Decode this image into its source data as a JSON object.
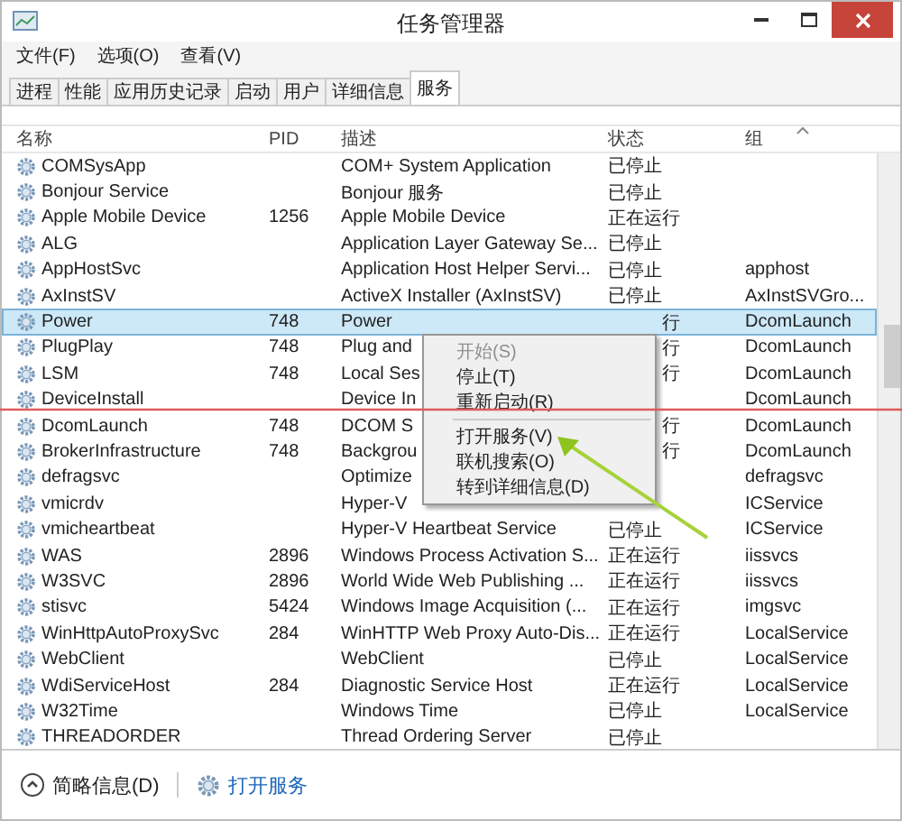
{
  "window": {
    "title": "任务管理器"
  },
  "menu": [
    "文件(F)",
    "选项(O)",
    "查看(V)"
  ],
  "tabs": [
    {
      "label": "进程",
      "selected": false
    },
    {
      "label": "性能",
      "selected": false
    },
    {
      "label": "应用历史记录",
      "selected": false
    },
    {
      "label": "启动",
      "selected": false
    },
    {
      "label": "用户",
      "selected": false
    },
    {
      "label": "详细信息",
      "selected": false
    },
    {
      "label": "服务",
      "selected": true
    }
  ],
  "table": {
    "columns": [
      "名称",
      "PID",
      "描述",
      "状态",
      "组"
    ],
    "rows": [
      {
        "name": "COMSysApp",
        "pid": "",
        "description": "COM+ System Application",
        "status": "已停止",
        "group": "",
        "selected": false,
        "covered": false
      },
      {
        "name": "Bonjour Service",
        "pid": "",
        "description": "Bonjour 服务",
        "status": "已停止",
        "group": "",
        "selected": false,
        "covered": false
      },
      {
        "name": "Apple Mobile Device",
        "pid": "1256",
        "description": "Apple Mobile Device",
        "status": "正在运行",
        "group": "",
        "selected": false,
        "covered": false
      },
      {
        "name": "ALG",
        "pid": "",
        "description": "Application Layer Gateway Se...",
        "status": "已停止",
        "group": "",
        "selected": false,
        "covered": false
      },
      {
        "name": "AppHostSvc",
        "pid": "",
        "description": "Application Host Helper Servi...",
        "status": "已停止",
        "group": "apphost",
        "selected": false,
        "covered": false
      },
      {
        "name": "AxInstSV",
        "pid": "",
        "description": "ActiveX Installer (AxInstSV)",
        "status": "已停止",
        "group": "AxInstSVGro...",
        "selected": false,
        "covered": false
      },
      {
        "name": "Power",
        "pid": "748",
        "description": "Power",
        "status": "行",
        "group": "DcomLaunch",
        "selected": true,
        "covered": true
      },
      {
        "name": "PlugPlay",
        "pid": "748",
        "description": "Plug and",
        "status": "行",
        "group": "DcomLaunch",
        "selected": false,
        "covered": true
      },
      {
        "name": "LSM",
        "pid": "748",
        "description": "Local Ses",
        "status": "行",
        "group": "DcomLaunch",
        "selected": false,
        "covered": true
      },
      {
        "name": "DeviceInstall",
        "pid": "",
        "description": "Device In",
        "status": "",
        "group": "DcomLaunch",
        "selected": false
      },
      {
        "name": "DcomLaunch",
        "pid": "748",
        "description": "DCOM S",
        "status": "行",
        "group": "DcomLaunch",
        "selected": false,
        "covered": true
      },
      {
        "name": "BrokerInfrastructure",
        "pid": "748",
        "description": "Backgrou",
        "status": "行",
        "group": "DcomLaunch",
        "selected": false,
        "covered": true
      },
      {
        "name": "defragsvc",
        "pid": "",
        "description": "Optimize",
        "status": "",
        "group": "defragsvc",
        "selected": false
      },
      {
        "name": "vmicrdv",
        "pid": "",
        "description": "Hyper-V",
        "status": "",
        "group": "ICService",
        "selected": false
      },
      {
        "name": "vmicheartbeat",
        "pid": "",
        "description": "Hyper-V Heartbeat Service",
        "status": "已停止",
        "group": "ICService",
        "selected": false,
        "covered": false
      },
      {
        "name": "WAS",
        "pid": "2896",
        "description": "Windows Process Activation S...",
        "status": "正在运行",
        "group": "iissvcs",
        "selected": false,
        "covered": false
      },
      {
        "name": "W3SVC",
        "pid": "2896",
        "description": "World Wide Web Publishing ...",
        "status": "正在运行",
        "group": "iissvcs",
        "selected": false,
        "covered": false
      },
      {
        "name": "stisvc",
        "pid": "5424",
        "description": "Windows Image Acquisition (...",
        "status": "正在运行",
        "group": "imgsvc",
        "selected": false,
        "covered": false
      },
      {
        "name": "WinHttpAutoProxySvc",
        "pid": "284",
        "description": "WinHTTP Web Proxy Auto-Dis...",
        "status": "正在运行",
        "group": "LocalService",
        "selected": false,
        "covered": false
      },
      {
        "name": "WebClient",
        "pid": "",
        "description": "WebClient",
        "status": "已停止",
        "group": "LocalService",
        "selected": false,
        "covered": false
      },
      {
        "name": "WdiServiceHost",
        "pid": "284",
        "description": "Diagnostic Service Host",
        "status": "正在运行",
        "group": "LocalService",
        "selected": false,
        "covered": false
      },
      {
        "name": "W32Time",
        "pid": "",
        "description": "Windows Time",
        "status": "已停止",
        "group": "LocalService",
        "selected": false,
        "covered": false
      },
      {
        "name": "THREADORDER",
        "pid": "",
        "description": "Thread Ordering Server",
        "status": "已停止",
        "group": "",
        "selected": false,
        "covered": false
      }
    ]
  },
  "context_menu": [
    {
      "kind": "item",
      "label": "开始(S)",
      "disabled": true
    },
    {
      "kind": "item",
      "label": "停止(T)",
      "disabled": false
    },
    {
      "kind": "item",
      "label": "重新启动(R)",
      "disabled": false
    },
    {
      "kind": "separator"
    },
    {
      "kind": "item",
      "label": "打开服务(V)",
      "disabled": false
    },
    {
      "kind": "item",
      "label": "联机搜索(O)",
      "disabled": false
    },
    {
      "kind": "item",
      "label": "转到详细信息(D)",
      "disabled": false
    }
  ],
  "footer": {
    "details": "简略信息(D)",
    "link": "打开服务"
  }
}
